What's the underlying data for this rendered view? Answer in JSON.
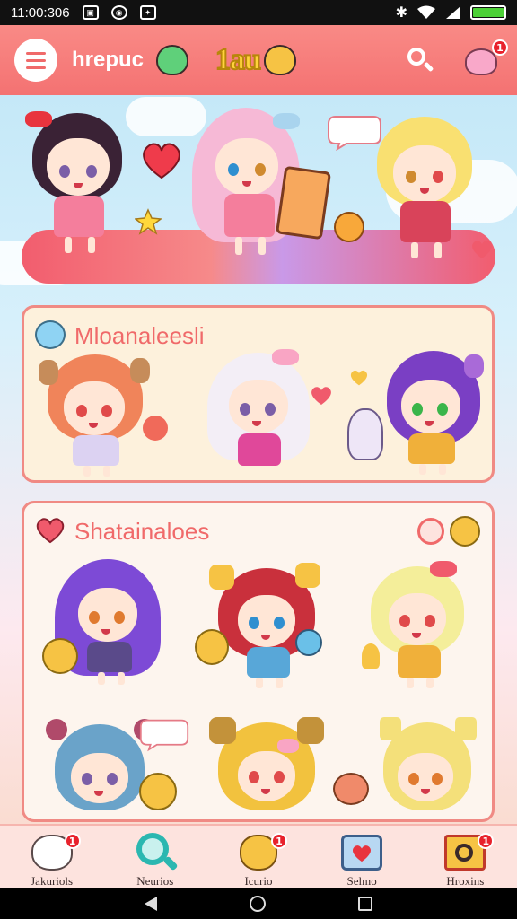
{
  "status_bar": {
    "time": "11:00:306",
    "icons": [
      "gallery-icon",
      "circle-app-icon",
      "game-icon",
      "bluetooth-icon",
      "wifi-icon",
      "signal-icon",
      "battery-icon"
    ],
    "battery_level": 1.0
  },
  "header": {
    "app_name": "hrepuc",
    "logo_text": "1au",
    "notification_count": "1"
  },
  "panels": [
    {
      "title": "Mloanaleesli",
      "icon": "ghost-icon"
    },
    {
      "title": "Shatainaloes",
      "icon": "heart-icon"
    }
  ],
  "bottom_nav": [
    {
      "label": "Jakuriols",
      "icon": "cat-face-icon",
      "badge": "1"
    },
    {
      "label": "Neurios",
      "icon": "magnifier-icon",
      "badge": ""
    },
    {
      "label": "Icurio",
      "icon": "bear-face-icon",
      "badge": "1"
    },
    {
      "label": "Selmo",
      "icon": "heart-card-icon",
      "badge": ""
    },
    {
      "label": "Hroxins",
      "icon": "photo-frame-icon",
      "badge": "1"
    }
  ],
  "colors": {
    "header": "#f47272",
    "accent": "#f06a6a",
    "panel_bg": "#fdf1dc",
    "nav_bg": "#fde3de"
  }
}
